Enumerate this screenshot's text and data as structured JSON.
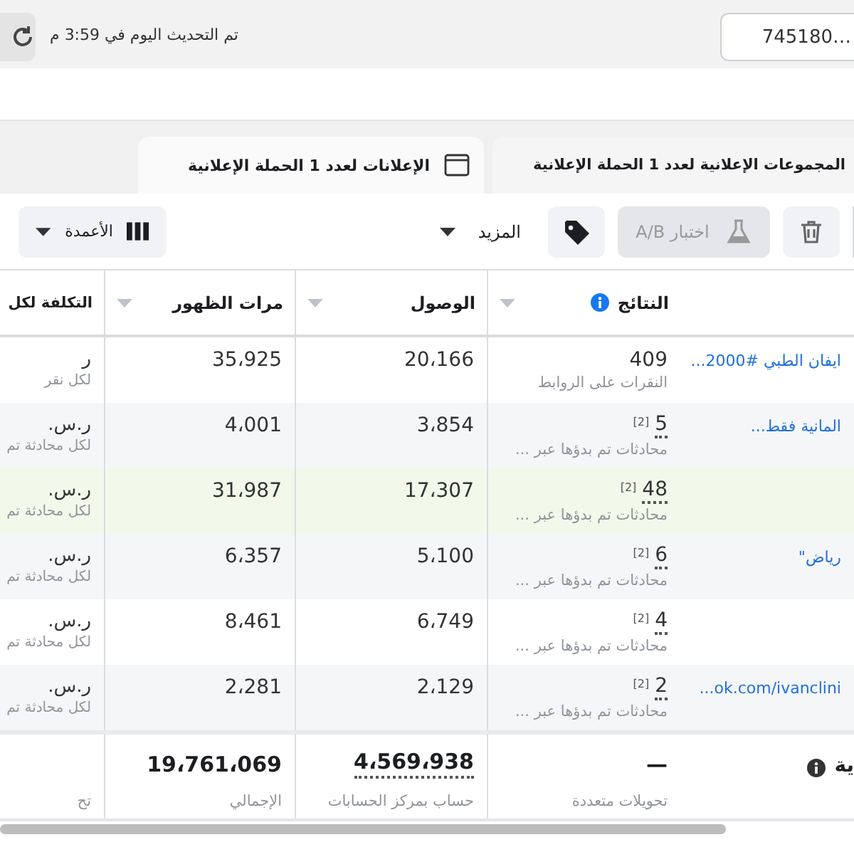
{
  "top_bar": {
    "account_selector": {
      "value": "…745180"
    },
    "updated_text": "تم التحديث اليوم في 3:59 م"
  },
  "tabs": [
    {
      "label": "المجموعات الإعلانية لعدد 1 الحملة الإعلانية",
      "selected": false
    },
    {
      "label": "الإعلانات لعدد 1 الحملة الإعلانية",
      "selected": true
    }
  ],
  "toolbar": [
    {
      "kind": "delete",
      "disabled": false
    },
    {
      "kind": "ab_test",
      "label": "اختبار A/B",
      "disabled": true
    },
    {
      "kind": "tag",
      "disabled": false
    },
    {
      "kind": "more",
      "label": "المزيد",
      "disabled": false
    },
    {
      "kind": "columns",
      "label": "الأعمدة",
      "disabled": false
    }
  ],
  "table": {
    "columns": [
      {
        "label": "النتائج",
        "info": true
      },
      {
        "label": "الوصول"
      },
      {
        "label": "مرات الظهور"
      },
      {
        "label": "التكلفة لكل"
      }
    ],
    "rows": [
      {
        "name": "ايفان الطبي #2000...",
        "highlighted": false,
        "results": "409",
        "results_label": "النقرات على الروابط",
        "reach": "20،166",
        "impressions": "35،925",
        "cost": "ر",
        "cost_label": "لكل نقر"
      },
      {
        "name": "المانية فقط...",
        "highlighted": false,
        "results": "5",
        "results_note": "[2]",
        "results_label": "محادثات تم بدؤها عبر ...",
        "reach": "3،854",
        "impressions": "4،001",
        "cost": "ر.س.",
        "cost_label": "لكل محادثة تم"
      },
      {
        "highlighted": true,
        "results": "48",
        "results_note": "[2]",
        "results_label": "محادثات تم بدؤها عبر ...",
        "reach": "17،307",
        "impressions": "31،987",
        "cost": "ر.س.",
        "cost_label": "لكل محادثة تم"
      },
      {
        "name": "رياض\"",
        "highlighted": false,
        "results": "6",
        "results_note": "[2]",
        "results_label": "محادثات تم بدؤها عبر ...",
        "reach": "5،100",
        "impressions": "6،357",
        "cost": "ر.س.",
        "cost_label": "لكل محادثة تم"
      },
      {
        "highlighted": false,
        "results": "4",
        "results_note": "[2]",
        "results_label": "محادثات تم بدؤها عبر ...",
        "reach": "6،749",
        "impressions": "8،461",
        "cost": "ر.س.",
        "cost_label": "لكل محادثة تم"
      },
      {
        "name": "...ok.com/ivanclini",
        "highlighted": false,
        "results": "2",
        "results_note": "[2]",
        "results_label": "محادثات تم بدؤها عبر ...",
        "reach": "2،129",
        "impressions": "2،281",
        "cost": "ر.س.",
        "cost_label": "لكل محادثة تم"
      }
    ],
    "totals": {
      "name": "ية",
      "results": "—",
      "results_label": "تحويلات متعددة",
      "reach": "4،569،938",
      "reach_label": "حساب بمركز الحسابات",
      "impressions": "19،761،069",
      "impressions_label": "الإجمالي",
      "cost_label": "تح"
    }
  }
}
